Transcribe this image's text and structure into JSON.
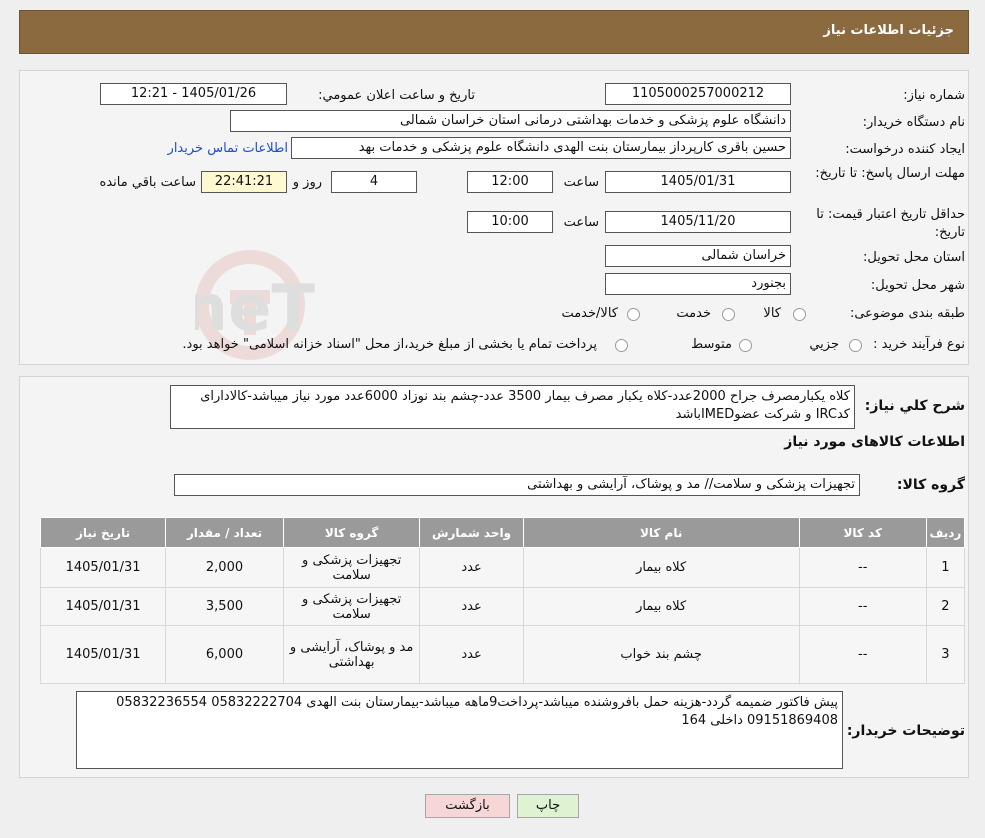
{
  "header": {
    "title": "جزئیات اطلاعات نیاز"
  },
  "fields": {
    "need_number_label": "شماره نیاز:",
    "need_number": "1105000257000212",
    "announce_label": "تاریخ و ساعت اعلان عمومي:",
    "announce_value": "1405/01/26 - 12:21",
    "buyer_org_label": "نام دستگاه خریدار:",
    "buyer_org": "دانشگاه علوم پزشکی و خدمات بهداشتی درمانی استان خراسان شمالی",
    "creator_label": "ایجاد کننده درخواست:",
    "creator": "حسین باقری کارپرداز بیمارستان بنت الهدی دانشگاه علوم پزشکی و خدمات بهد",
    "contact_link": "اطلاعات تماس خریدار",
    "deadline_label": "مهلت ارسال پاسخ: تا تاریخ:",
    "deadline_date": "1405/01/31",
    "time_label": "ساعت",
    "deadline_time": "12:00",
    "days": "4",
    "day_label": "روز و",
    "remaining_time": "22:41:21",
    "remaining_label": "ساعت باقي مانده",
    "validity_label": "حداقل تاریخ اعتبار قیمت: تا تاریخ:",
    "validity_date": "1405/11/20",
    "validity_time": "10:00",
    "province_label": "استان محل تحویل:",
    "province": "خراسان شمالی",
    "city_label": "شهر محل تحویل:",
    "city": "بجنورد",
    "category_label": "طبقه بندی موضوعی:",
    "cat_options": [
      "کالا",
      "خدمت",
      "کالا/خدمت"
    ],
    "process_label": "نوع فرآیند خرید :",
    "process_options": [
      "جزیي",
      "متوسط"
    ],
    "process_note": "پرداخت تمام یا بخشی از مبلغ خرید،از محل \"اسناد خزانه اسلامی\" خواهد بود."
  },
  "summary": {
    "label": "شرح کلي نياز:",
    "text": "کلاه یکبارمصرف جراح 2000عدد-کلاه یکبار مصرف بیمار 3500 عدد-چشم بند نوزاد 6000عدد مورد نیاز میباشد-کالادارای کدIRC و شرکت عضوIMEDباشد",
    "goods_info_title": "اطلاعات کالاهای مورد نیاز",
    "goods_group_label": "گروه کالا:",
    "goods_group": "تجهیزات پزشکی و سلامت// مد و پوشاک، آرایشی و بهداشتی"
  },
  "table": {
    "headers": [
      "ردیف",
      "کد کالا",
      "نام کالا",
      "واحد شمارش",
      "گروه کالا",
      "تعداد / مقدار",
      "تاریخ نیاز"
    ],
    "rows": [
      [
        "1",
        "--",
        "کلاه بیمار",
        "عدد",
        "تجهیزات پزشکی و سلامت",
        "2,000",
        "1405/01/31"
      ],
      [
        "2",
        "--",
        "کلاه بیمار",
        "عدد",
        "تجهیزات پزشکی و سلامت",
        "3,500",
        "1405/01/31"
      ],
      [
        "3",
        "--",
        "چشم بند خواب",
        "عدد",
        "مد و پوشاک، آرایشی و بهداشتی",
        "6,000",
        "1405/01/31"
      ]
    ]
  },
  "notes": {
    "label": "توضیحات خریدار:",
    "text": "پیش فاکتور ضمیمه گردد-هزینه حمل بافروشنده میباشد-پرداخت9ماهه میباشد-بیمارستان بنت الهدی 05832222704 05832236554 09151869408  داخلی 164"
  },
  "buttons": {
    "print": "چاپ",
    "back": "بازگشت"
  },
  "watermark": {
    "text": "AriaTender.neT"
  },
  "colors": {
    "header": "#8b6a3f",
    "link": "#1a4fd6",
    "table_header": "#9a9a9a",
    "back_button": "#f6d6d6",
    "print_button": "#dff3d3"
  }
}
